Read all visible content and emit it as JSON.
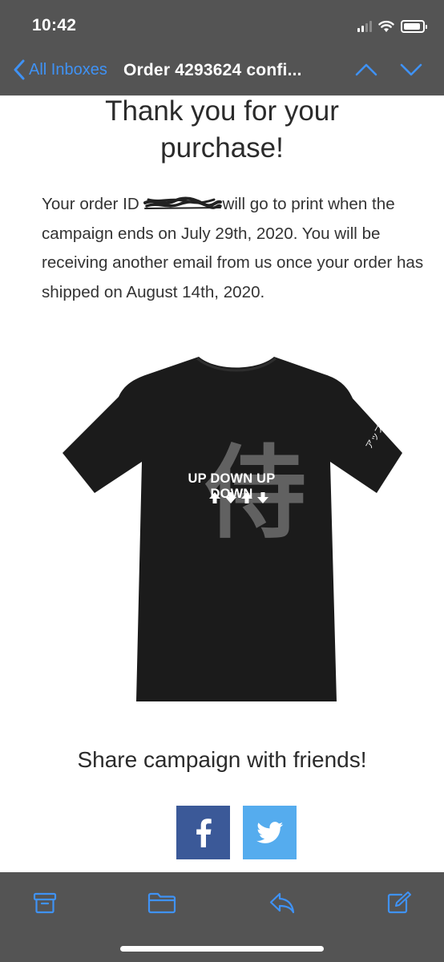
{
  "status_bar": {
    "time": "10:42",
    "icons": [
      "signal-icon",
      "wifi-icon",
      "battery-icon"
    ]
  },
  "nav": {
    "back_label": "All Inboxes",
    "title": "Order 4293624 confi...",
    "prev_icon": "chevron-up-icon",
    "next_icon": "chevron-down-icon",
    "accent_color": "#3f92f5",
    "bar_color": "#545454"
  },
  "email": {
    "headline": "Thank you for your purchase!",
    "body_before": "Your order ID ",
    "body_after": "will go to print when the campaign ends on July 29th, 2020. You will be receiving another email from us once your order has shipped on August 14th, 2020.",
    "product": {
      "print_text": "UP DOWN UP DOWN",
      "print_arrows": [
        "up",
        "down",
        "up",
        "down"
      ],
      "kanji": "侍",
      "sleeve_text": "アップ・ダ",
      "shirt_color": "#1b1b1b"
    },
    "share_heading": "Share campaign with friends!",
    "share_buttons": [
      {
        "name": "facebook",
        "icon": "facebook-icon",
        "color": "#3b5998"
      },
      {
        "name": "twitter",
        "icon": "twitter-icon",
        "color": "#55acee"
      }
    ]
  },
  "toolbar": {
    "buttons": [
      "archive-icon",
      "folder-icon",
      "reply-icon",
      "compose-icon"
    ],
    "icon_color": "#3f92f5"
  }
}
